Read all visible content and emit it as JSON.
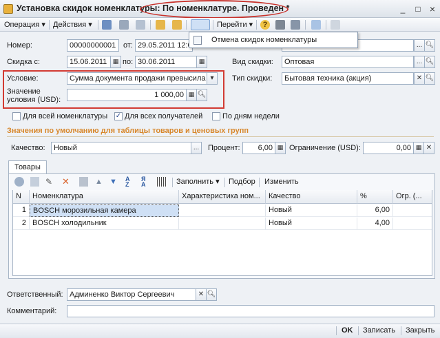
{
  "window": {
    "title": "Установка скидок номенклатуры: По номенклатуре. Проведен *",
    "minimize": "_",
    "maximize": "□",
    "close": "×"
  },
  "toolbar": {
    "operation_label": "Операция",
    "actions_label": "Действия",
    "goto_label": "Перейти",
    "help": "?"
  },
  "popup": {
    "item_label": "Отмена скидок номенклатуры"
  },
  "form": {
    "number_label": "Номер:",
    "number_value": "00000000001",
    "from_label": "от:",
    "from_value": "29.05.2011 12:0",
    "discount_from_label": "Скидка с:",
    "discount_from_value": "15.06.2011",
    "discount_to_label": "по:",
    "discount_to_value": "30.06.2011",
    "discount_kind_label": "Вид скидки:",
    "discount_kind_value": "Оптовая",
    "condition_label": "Условие:",
    "condition_value": "Сумма документа продажи превысила",
    "condition_amount_label_1": "Значение",
    "condition_amount_label_2": "условия (USD):",
    "condition_amount_value": "1 000,00",
    "price_type_label": "Тип скидки:",
    "price_type_value": "Бытовая техника (акция)",
    "all_items_label": "Для всей номенклатуры",
    "all_items_checked": false,
    "all_recipients_label": "Для всех получателей",
    "all_recipients_checked": true,
    "by_weekdays_label": "По дням недели",
    "by_weekdays_checked": false,
    "defaults_section": "Значения по умолчанию для таблицы товаров и ценовых групп",
    "quality_label": "Качество:",
    "quality_value": "Новый",
    "percent_label": "Процент:",
    "percent_value": "6,00",
    "limit_label": "Ограничение (USD):",
    "limit_value": "0,00"
  },
  "tabs": [
    {
      "label": "Товары"
    }
  ],
  "table_toolbar": {
    "fill_label": "Заполнить",
    "select_label": "Подбор",
    "change_label": "Изменить"
  },
  "table": {
    "columns": [
      "N",
      "Номенклатура",
      "Характеристика ном...",
      "Качество",
      "%",
      "Огр. (..."
    ],
    "rows": [
      {
        "n": "1",
        "item": "BOSCH морозильная камера",
        "characteristic": "",
        "quality": "Новый",
        "percent": "6,00",
        "limit": ""
      },
      {
        "n": "2",
        "item": "BOSCH холодильник",
        "characteristic": "",
        "quality": "Новый",
        "percent": "4,00",
        "limit": ""
      }
    ]
  },
  "footer": {
    "responsible_label": "Ответственный:",
    "responsible_value": "Админенко Виктор Сергеевич",
    "comment_label": "Комментарий:",
    "comment_value": "",
    "ok_label": "OK",
    "save_label": "Записать",
    "close_label": "Закрыть"
  },
  "colors": {
    "highlight_red": "#d23a32",
    "section_orange": "#d8872b",
    "selection_blue": "#cfe0f5"
  }
}
